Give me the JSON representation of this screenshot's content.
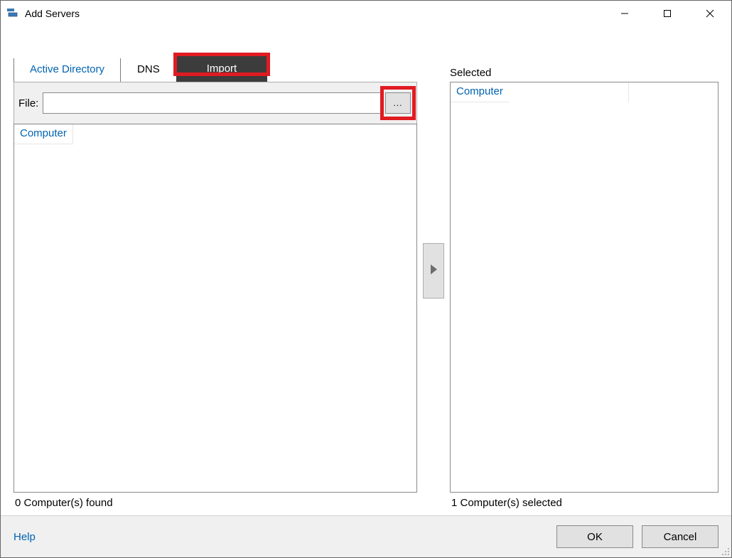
{
  "window": {
    "title": "Add Servers"
  },
  "tabs": {
    "active_directory": "Active Directory",
    "dns": "DNS",
    "import": "Import"
  },
  "file": {
    "label": "File:",
    "value": "",
    "browse_label": "..."
  },
  "left": {
    "column_header": "Computer",
    "status": "0 Computer(s) found"
  },
  "right": {
    "title": "Selected",
    "column_header": "Computer",
    "status": "1 Computer(s) selected"
  },
  "footer": {
    "help": "Help",
    "ok": "OK",
    "cancel": "Cancel"
  }
}
